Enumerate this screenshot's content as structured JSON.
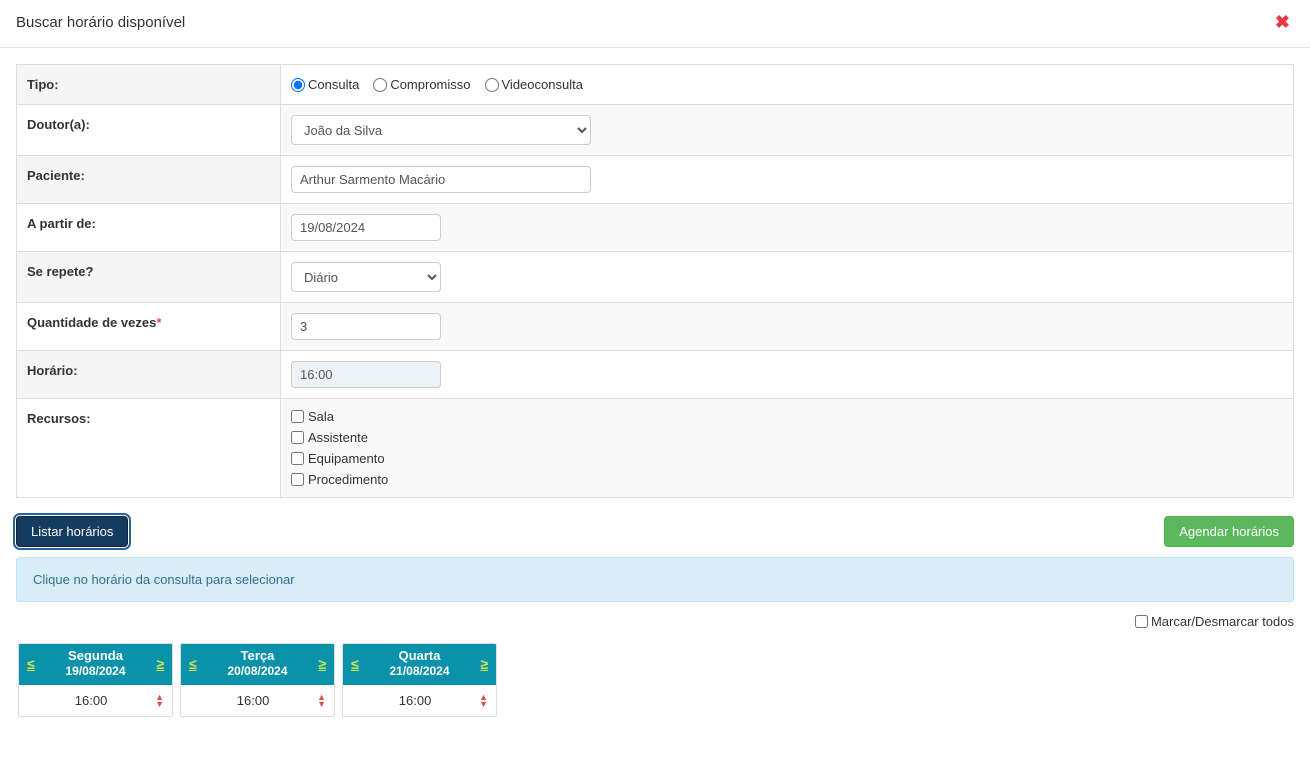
{
  "header": {
    "title": "Buscar horário disponível"
  },
  "form": {
    "tipo": {
      "label": "Tipo:",
      "opt1": "Consulta",
      "opt2": "Compromisso",
      "opt3": "Videoconsulta"
    },
    "doutor": {
      "label": "Doutor(a):",
      "value": "João da Silva"
    },
    "paciente": {
      "label": "Paciente:",
      "value": "Arthur Sarmento Macário"
    },
    "apartirde": {
      "label": "A partir de:",
      "value": "19/08/2024"
    },
    "serepete": {
      "label": "Se repete?",
      "value": "Diário"
    },
    "qtd": {
      "label": "Quantidade de vezes",
      "value": "3"
    },
    "horario": {
      "label": "Horário:",
      "value": "16:00"
    },
    "recursos": {
      "label": "Recursos:",
      "r1": "Sala",
      "r2": "Assistente",
      "r3": "Equipamento",
      "r4": "Procedimento"
    }
  },
  "buttons": {
    "list": "Listar horários",
    "schedule": "Agendar horários"
  },
  "info": "Clique no horário da consulta para selecionar",
  "toggleAll": "Marcar/Desmarcar todos",
  "arrowLeft": "≤",
  "arrowRight": "≥",
  "days": [
    {
      "name": "Segunda",
      "date": "19/08/2024",
      "time": "16:00"
    },
    {
      "name": "Terça",
      "date": "20/08/2024",
      "time": "16:00"
    },
    {
      "name": "Quarta",
      "date": "21/08/2024",
      "time": "16:00"
    }
  ]
}
